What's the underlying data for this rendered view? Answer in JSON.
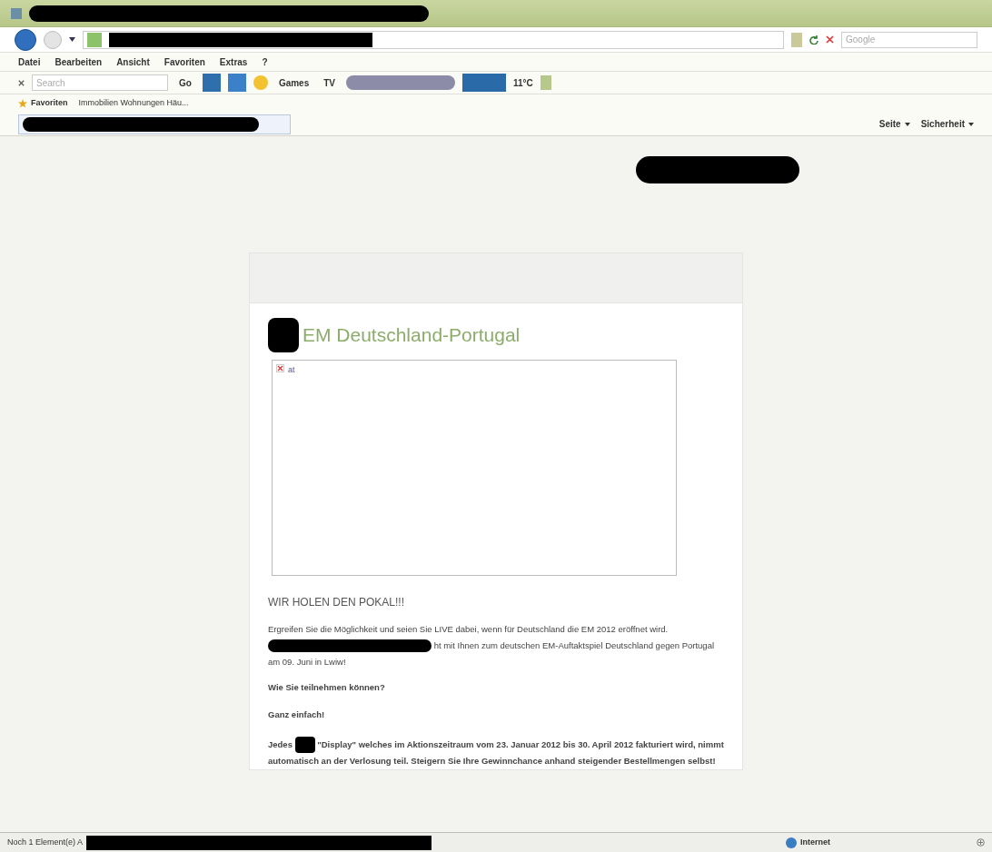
{
  "menu_bar": [
    "Datei",
    "Bearbeiten",
    "Ansicht",
    "Favoriten",
    "Extras",
    "?"
  ],
  "search_bar": {
    "placeholder": "Google"
  },
  "toolbar": {
    "search": {
      "placeholder": "Search"
    },
    "go": "Go",
    "games": "Games",
    "tv": "TV",
    "weather": "11°C"
  },
  "favorites_bar": {
    "favorites": "Favoriten",
    "items": [
      "Immobilien Wohnungen Häu..."
    ]
  },
  "command_bar": [
    "Seite",
    "Sicherheit"
  ],
  "article": {
    "title": "EM Deutschland-Portugal",
    "image_alt": "at",
    "heading": "WIR HOLEN DEN POKAL!!!",
    "intro_start": "Ergreifen Sie die Möglichkeit und seien Sie LIVE dabei, wenn für Deutschland die EM 2012 eröffnet wird.",
    "intro_end": "ht mit Ihnen zum deutschen EM-Auftaktspiel Deutschland gegen Portugal am 09. Juni in Lwiw!",
    "question": "Wie Sie teilnehmen können?",
    "answer": "Ganz einfach!",
    "rules_start": "Jedes",
    "rules_end": "\"Display\" welches im Aktionszeitraum vom 23. Januar 2012 bis 30. April 2012 fakturiert wird, nimmt automatisch an der Verlosung teil. Steigern Sie Ihre Gewinnchance anhand steigender Bestellmengen selbst!"
  },
  "status_bar": {
    "text": "Noch 1 Element(e) A",
    "zone": "Internet"
  }
}
